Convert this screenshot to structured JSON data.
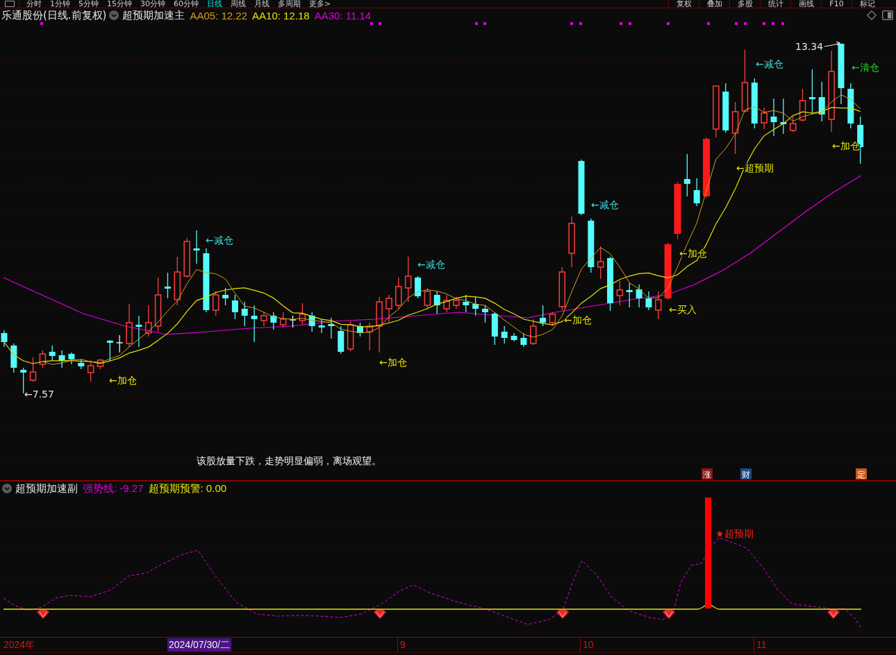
{
  "toolbar": {
    "period_tabs": [
      {
        "label": "分时",
        "selected": false
      },
      {
        "label": "1分钟",
        "selected": false
      },
      {
        "label": "5分钟",
        "selected": false
      },
      {
        "label": "15分钟",
        "selected": false
      },
      {
        "label": "30分钟",
        "selected": false
      },
      {
        "label": "60分钟",
        "selected": false
      },
      {
        "label": "日线",
        "selected": true
      },
      {
        "label": "周线",
        "selected": false
      },
      {
        "label": "月线",
        "selected": false
      },
      {
        "label": "多周期",
        "selected": false
      },
      {
        "label": "更多>",
        "selected": false
      }
    ],
    "tools": [
      "复权",
      "叠加",
      "多股",
      "统计",
      "画线",
      "F10",
      "标记"
    ]
  },
  "main_chart": {
    "title": "乐通股份(日线.前复权)",
    "indicator": "超预期加速主",
    "readings": [
      {
        "label": "AA05: 12.22",
        "color": "#d69e1c"
      },
      {
        "label": "AA10: 12.18",
        "color": "#e6e600"
      },
      {
        "label": "AA30: 11.14",
        "color": "#e000e0"
      }
    ],
    "high_label": "13.34",
    "low_label": "←7.57",
    "annotations": [
      {
        "text": "←加仓",
        "color": "#e6e600"
      },
      {
        "text": "←减仓",
        "color": "#40dcdc"
      },
      {
        "text": "←加仓",
        "color": "#e6e600"
      },
      {
        "text": "←减仓",
        "color": "#40dcdc"
      },
      {
        "text": "←加仓",
        "color": "#e6e600"
      },
      {
        "text": "←减仓",
        "color": "#40dcdc"
      },
      {
        "text": "←买入",
        "color": "#e6e600"
      },
      {
        "text": "←加仓",
        "color": "#e6e600"
      },
      {
        "text": "←超预期",
        "color": "#e6e600"
      },
      {
        "text": "←减仓",
        "color": "#40dcdc"
      },
      {
        "text": "←加仓",
        "color": "#e6e600"
      },
      {
        "text": "←清仓",
        "color": "#20d820"
      }
    ],
    "comment": "该股放量下跌，走势明显偏弱，离场观望。",
    "event_markers": [
      {
        "label": "涨",
        "color": "#8c1414"
      },
      {
        "label": "财",
        "color": "#1c4c88"
      },
      {
        "label": "定",
        "color": "#c4581c"
      }
    ]
  },
  "sub_chart": {
    "indicator": "超预期加速副",
    "readings": [
      {
        "label": "强势线: -9.27",
        "color": "#e000e0"
      },
      {
        "label": "超预期预警: 0.00",
        "color": "#e6e600"
      }
    ],
    "signal_label": "★超预期"
  },
  "time_axis": {
    "year": "2024年",
    "cursor_date": "2024/07/30/二",
    "months": [
      "9",
      "10",
      "11"
    ]
  }
}
